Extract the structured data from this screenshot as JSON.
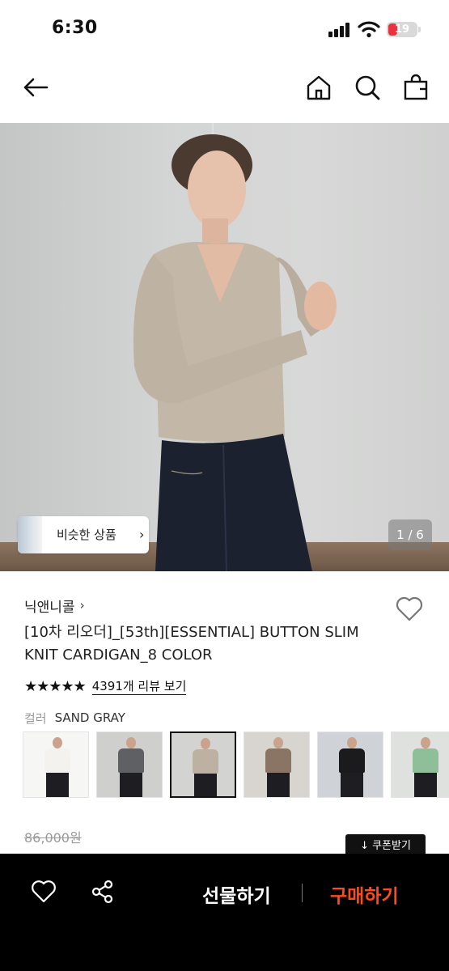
{
  "status_bar": {
    "time": "6:30",
    "battery": "19"
  },
  "hero": {
    "similar_label": "비슷한 상품",
    "page_indicator": "1 / 6"
  },
  "product": {
    "brand": "닉앤니콜",
    "title": "[10차 리오더]_[53th][ESSENTIAL] BUTTON SLIM KNIT CARDIGAN_8 COLOR",
    "stars": "★★★★★",
    "review_text": "4391개 리뷰 보기",
    "color_label": "컬러",
    "color_value": "SAND GRAY",
    "original_price": "86,000원",
    "coupon_label": "↓ 쿠폰받기"
  },
  "color_options": [
    {
      "name": "white",
      "swatch": "#f3f2ee",
      "selected": false
    },
    {
      "name": "charcoal",
      "swatch": "#5e6064",
      "selected": false
    },
    {
      "name": "sand gray",
      "swatch": "#bdb2a2",
      "selected": true
    },
    {
      "name": "mocha",
      "swatch": "#8a7464",
      "selected": false
    },
    {
      "name": "black",
      "swatch": "#1b1b1d",
      "selected": false
    },
    {
      "name": "mint",
      "swatch": "#8fbf99",
      "selected": false
    }
  ],
  "bottom_bar": {
    "gift_label": "선물하기",
    "buy_label": "구매하기"
  },
  "colors": {
    "buy_accent": "#ff4a1c",
    "battery_low": "#e8333f"
  },
  "icons": [
    "back-arrow-icon",
    "home-icon",
    "search-icon",
    "shopping-bag-icon",
    "heart-icon",
    "share-icon"
  ]
}
